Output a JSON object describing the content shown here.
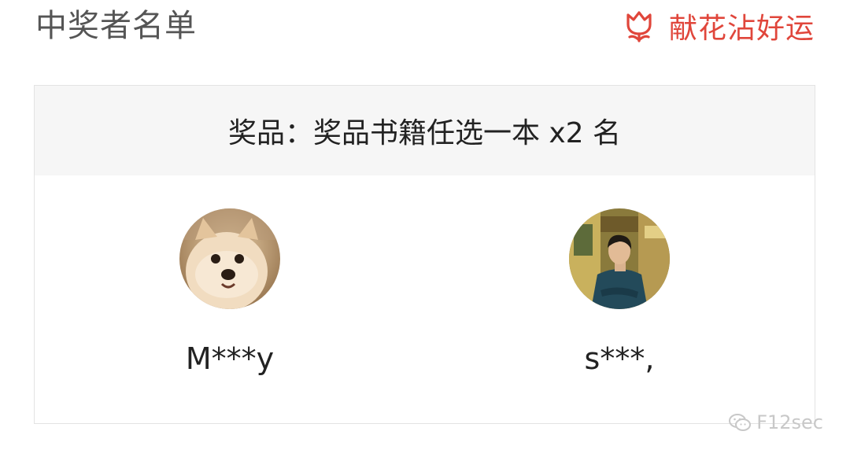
{
  "header": {
    "title": "中奖者名单",
    "flower_label": "献花沾好运",
    "accent_color": "#e0463b"
  },
  "prize": {
    "label": "奖品：奖品书籍任选一本 x2 名"
  },
  "winners": [
    {
      "name": "M***y",
      "avatar": "dog-photo-avatar"
    },
    {
      "name": "s***,",
      "avatar": "person-photo-avatar"
    }
  ],
  "watermark": {
    "text": "F12sec",
    "icon": "wechat-icon"
  }
}
